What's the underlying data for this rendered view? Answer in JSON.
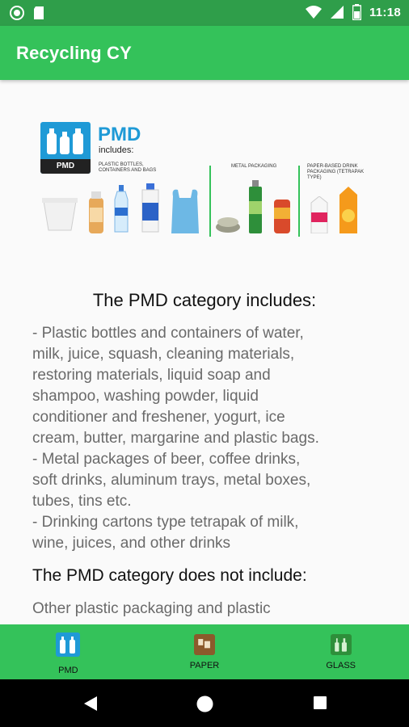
{
  "status_bar": {
    "time": "11:18",
    "left_icons": [
      "circle-icon",
      "sd-card-icon"
    ],
    "right_icons": [
      "wifi-icon",
      "signal-icon",
      "battery-icon"
    ]
  },
  "app_bar": {
    "title": "Recycling CY"
  },
  "banner": {
    "logo_text": "PMD",
    "title": "PMD",
    "subtitle": "includes:",
    "captions": [
      "PLASTIC BOTTLES, CONTAINERS AND BAGS",
      "METAL PACKAGING",
      "PAPER-BASED DRINK PACKAGING (TETRAPAK TYPE)"
    ]
  },
  "content": {
    "includes_title": "The PMD category includes:",
    "includes_lines": [
      "- Plastic bottles and containers of water,",
      "milk, juice, squash, cleaning materials,",
      "restoring materials, liquid soap and",
      "shampoo, washing powder, liquid",
      "conditioner and freshener, yogurt, ice",
      "cream, butter, margarine and plastic bags.",
      "- Metal packages of beer, coffee drinks,",
      "soft drinks, aluminum trays, metal boxes,",
      "tubes, tins etc.",
      "- Drinking cartons type tetrapak of milk,",
      "wine, juices, and other drinks"
    ],
    "not_include_title": "The PMD category does not include:",
    "not_include_lines": [
      "Other plastic packaging and plastic"
    ]
  },
  "bottom_nav": {
    "selected": "PMD",
    "items": [
      {
        "label": "PMD",
        "icon": "pmd-bottles-icon"
      },
      {
        "label": "PAPER",
        "icon": "paper-icon"
      },
      {
        "label": "GLASS",
        "icon": "glass-bottles-icon"
      }
    ]
  },
  "system_nav": {
    "buttons": [
      "back-icon",
      "home-icon",
      "recents-icon"
    ]
  },
  "colors": {
    "status_bar": "#2f9e4a",
    "app_bar": "#34c25a",
    "pmd_blue": "#1f9ad6",
    "body_text": "#6a6a6a"
  }
}
